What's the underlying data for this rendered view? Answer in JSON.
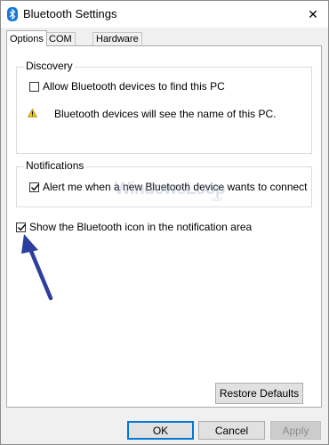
{
  "window": {
    "title": "Bluetooth Settings",
    "close_glyph": "✕"
  },
  "tabs": [
    {
      "label": "Options",
      "active": true
    },
    {
      "label": "COM Ports",
      "active": false
    },
    {
      "label": "Hardware",
      "active": false
    }
  ],
  "discovery": {
    "group_label": "Discovery",
    "allow_label": "Allow Bluetooth devices to find this PC",
    "allow_checked": false,
    "warning_text": "Bluetooth devices will see the name of this PC."
  },
  "notifications": {
    "group_label": "Notifications",
    "alert_label": "Alert me when a new Bluetooth device wants to connect",
    "alert_checked": true
  },
  "show_icon": {
    "label": "Show the Bluetooth icon in the notification area",
    "checked": true
  },
  "watermark": {
    "text": "WindowsLoop",
    "sub": ".com"
  },
  "buttons": {
    "restore_defaults": "Restore Defaults",
    "ok": "OK",
    "cancel": "Cancel",
    "apply": "Apply"
  },
  "colors": {
    "bluetooth_blue": "#1479d8",
    "arrow_blue": "#2c3e9e",
    "warning_yellow": "#f2c40f",
    "focus_blue": "#0078d7"
  }
}
